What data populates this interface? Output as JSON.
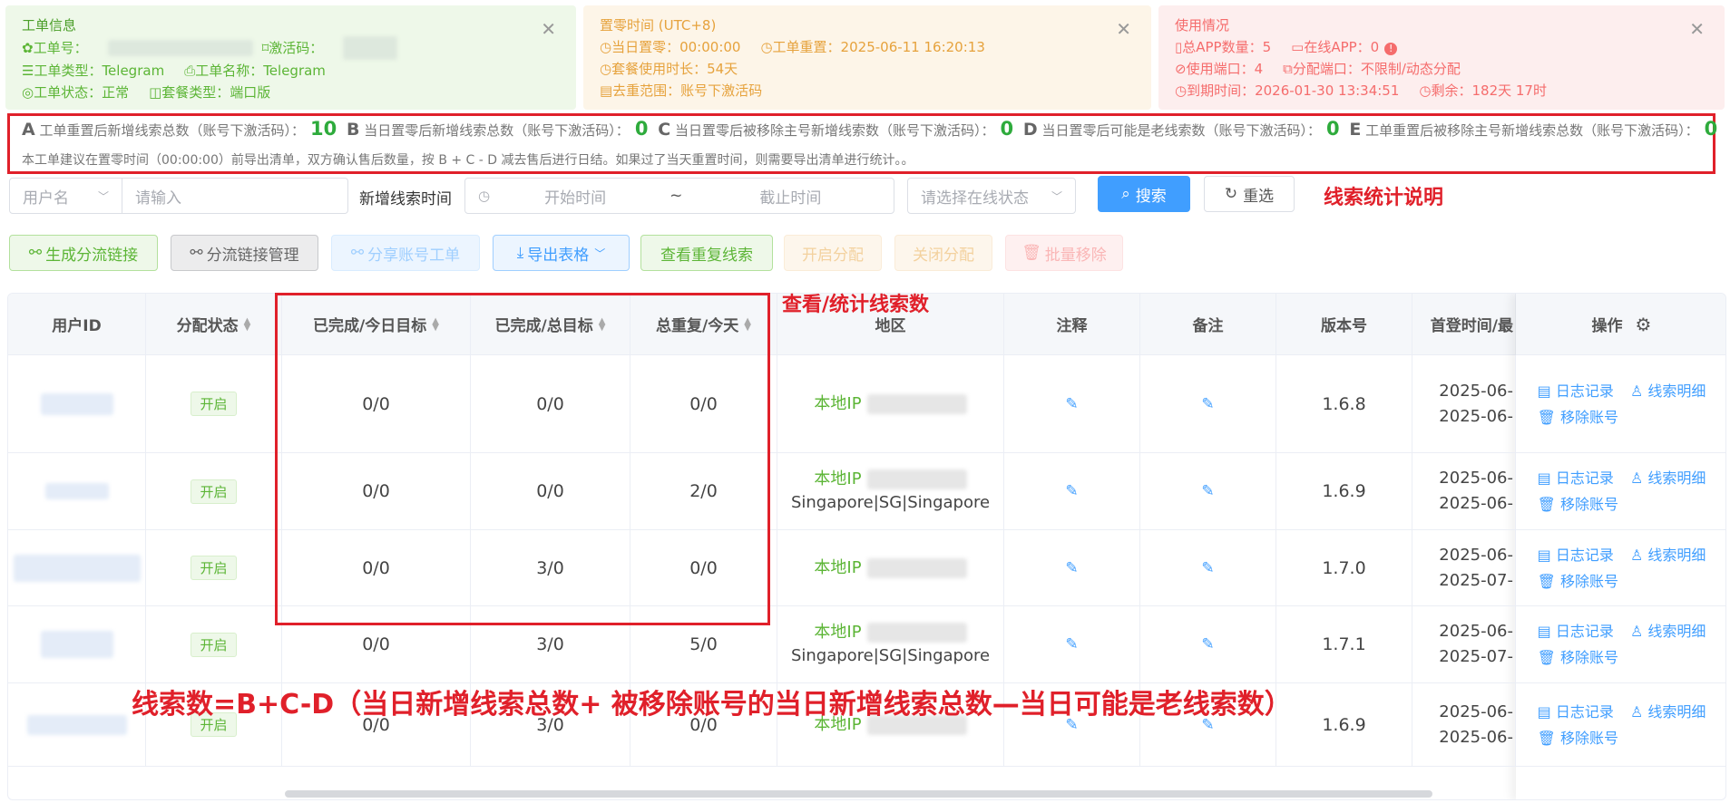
{
  "cards": {
    "order": {
      "title": "工单信息",
      "order_no_label": "✿工单号：",
      "activation_label": "⌑激活码：",
      "order_type": "☰工单类型：Telegram",
      "order_name": "⎙工单名称：Telegram",
      "order_status": "◎工单状态：正常",
      "package_type": "◫套餐类型：端口版"
    },
    "reset": {
      "title": "置零时间 (UTC+8)",
      "day_reset": "◷当日置零：00:00:00",
      "order_reset": "◷工单重置：2025-06-11 16:20:13",
      "package_duration": "◷套餐使用时长：54天",
      "dedup_scope": "▤去重范围：账号下激活码"
    },
    "usage": {
      "title": "使用情况",
      "total_app": "▯总APP数量：5",
      "online_app": "▭在线APP：0",
      "used_port": "⊘使用端口：4",
      "assigned_port": "⧉分配端口：不限制/动态分配",
      "expire": "◷到期时间：2026-01-30 13:34:51",
      "remain": "◷剩余：182天 17时"
    }
  },
  "stats": {
    "a_label": "A",
    "a_text": "工单重置后新增线索总数（账号下激活码）：",
    "a_value": "10",
    "b_label": "B",
    "b_text": "当日置零后新增线索总数（账号下激活码）：",
    "b_value": "0",
    "c_label": "C",
    "c_text": "当日置零后被移除主号新增线索数（账号下激活码）：",
    "c_value": "0",
    "d_label": "D",
    "d_text": "当日置零后可能是老线索数（账号下激活码）：",
    "d_value": "0",
    "e_label": "E",
    "e_text": "工单重置后被移除主号新增线索总数（账号下激活码）：",
    "e_value": "0",
    "note": "本工单建议在置零时间（00:00:00）前导出清单，双方确认售后数量，按 B + C - D 减去售后进行日结。如果过了当天重置时间，则需要导出清单进行统计。。"
  },
  "filters": {
    "user_select": "用户名",
    "input_placeholder": "请输入",
    "new_clue_time_label": "新增线索时间",
    "start_placeholder": "开始时间",
    "range_sep": "~",
    "end_placeholder": "截止时间",
    "online_status_placeholder": "请选择在线状态",
    "search_btn": "搜索",
    "reset_btn": "重选"
  },
  "toolbar": {
    "gen_link": "生成分流链接",
    "link_manage": "分流链接管理",
    "share_order": "分享账号工单",
    "export": "导出表格",
    "view_dup": "查看重复线索",
    "enable_assign": "开启分配",
    "disable_assign": "关闭分配",
    "batch_remove": "批量移除"
  },
  "annotations": {
    "clue_stat_desc": "线索统计说明",
    "view_stat": "查看/统计线索数",
    "formula": "线索数=B+C-D（当日新增线索总数+ 被移除账号的当日新增线索总数—当日可能是老线索数）"
  },
  "table": {
    "headers": [
      "用户ID",
      "分配状态",
      "已完成/今日目标",
      "已完成/总目标",
      "总重复/今天",
      "地区",
      "注释",
      "备注",
      "版本号",
      "首登时间/最",
      "操作"
    ],
    "rows": [
      {
        "status": "开启",
        "today": "0/0",
        "total": "0/0",
        "dup": "0/0",
        "region_ip": "本地IP",
        "region_loc": "",
        "version": "1.6.8",
        "time1": "2025-06-",
        "time2": "2025-06-"
      },
      {
        "status": "开启",
        "today": "0/0",
        "total": "0/0",
        "dup": "2/0",
        "region_ip": "本地IP",
        "region_loc": "Singapore|SG|Singapore",
        "version": "1.6.9",
        "time1": "2025-06-",
        "time2": "2025-06-"
      },
      {
        "status": "开启",
        "today": "0/0",
        "total": "3/0",
        "dup": "0/0",
        "region_ip": "本地IP",
        "region_loc": "",
        "version": "1.7.0",
        "time1": "2025-06-",
        "time2": "2025-07-"
      },
      {
        "status": "开启",
        "today": "0/0",
        "total": "3/0",
        "dup": "5/0",
        "region_ip": "本地IP",
        "region_loc": "Singapore|SG|Singapore",
        "version": "1.7.1",
        "time1": "2025-06-",
        "time2": "2025-07-"
      },
      {
        "status": "开启",
        "today": "0/0",
        "total": "3/0",
        "dup": "0/0",
        "region_ip": "本地IP",
        "region_loc": "",
        "version": "1.6.9",
        "time1": "2025-06-",
        "time2": "2025-06-"
      }
    ],
    "actions": {
      "log": "日志记录",
      "clue_detail": "线索明细",
      "remove": "移除账号"
    }
  },
  "colors": {
    "accent": "#409eff",
    "annotation_red": "#e0202a",
    "stat_green": "#2eab3c"
  }
}
